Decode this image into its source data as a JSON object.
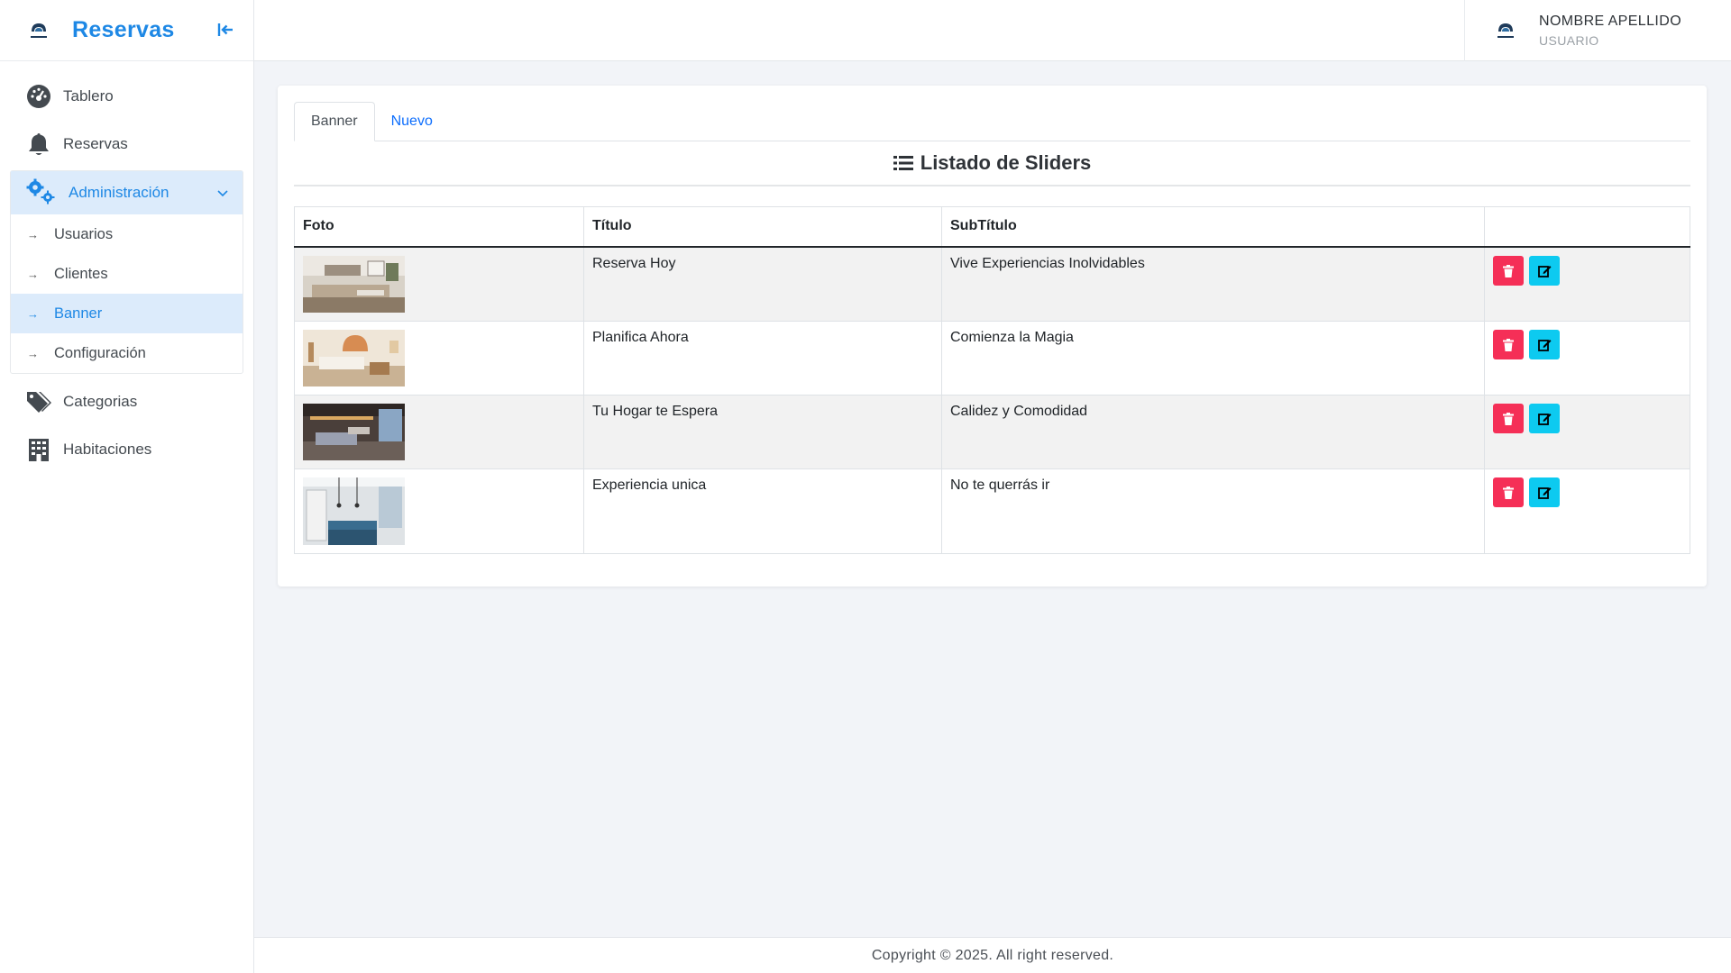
{
  "brand": {
    "title": "Reservas"
  },
  "sidebar": {
    "items": [
      {
        "label": "Tablero",
        "icon": "dashboard-icon"
      },
      {
        "label": "Reservas",
        "icon": "bell-icon"
      }
    ],
    "admin_group": {
      "label": "Administración",
      "icon": "gears-icon",
      "subitems": [
        {
          "label": "Usuarios"
        },
        {
          "label": "Clientes"
        },
        {
          "label": "Banner"
        },
        {
          "label": "Configuración"
        }
      ]
    },
    "bottom_items": [
      {
        "label": "Categorias",
        "icon": "tags-icon"
      },
      {
        "label": "Habitaciones",
        "icon": "building-icon"
      }
    ]
  },
  "header": {
    "user_name": "NOMBRE APELLIDO",
    "user_role": "USUARIO"
  },
  "tabs": [
    {
      "label": "Banner",
      "active": true
    },
    {
      "label": "Nuevo",
      "active": false
    }
  ],
  "list_title": "Listado de Sliders",
  "table": {
    "headers": [
      "Foto",
      "Título",
      "SubTítulo",
      ""
    ],
    "rows": [
      {
        "titulo": "Reserva Hoy",
        "subtitulo": "Vive Experiencias Inolvidables"
      },
      {
        "titulo": "Planifica Ahora",
        "subtitulo": "Comienza la Magia"
      },
      {
        "titulo": "Tu Hogar te Espera",
        "subtitulo": "Calidez y Comodidad"
      },
      {
        "titulo": "Experiencia unica",
        "subtitulo": "No te querrás ir"
      }
    ]
  },
  "footer": {
    "text": "Copyright © 2025. All right reserved."
  },
  "colors": {
    "accent": "#1e88e5",
    "delete": "#f52f57",
    "edit": "#0dcaf0",
    "active_bg": "#dcebfb"
  }
}
